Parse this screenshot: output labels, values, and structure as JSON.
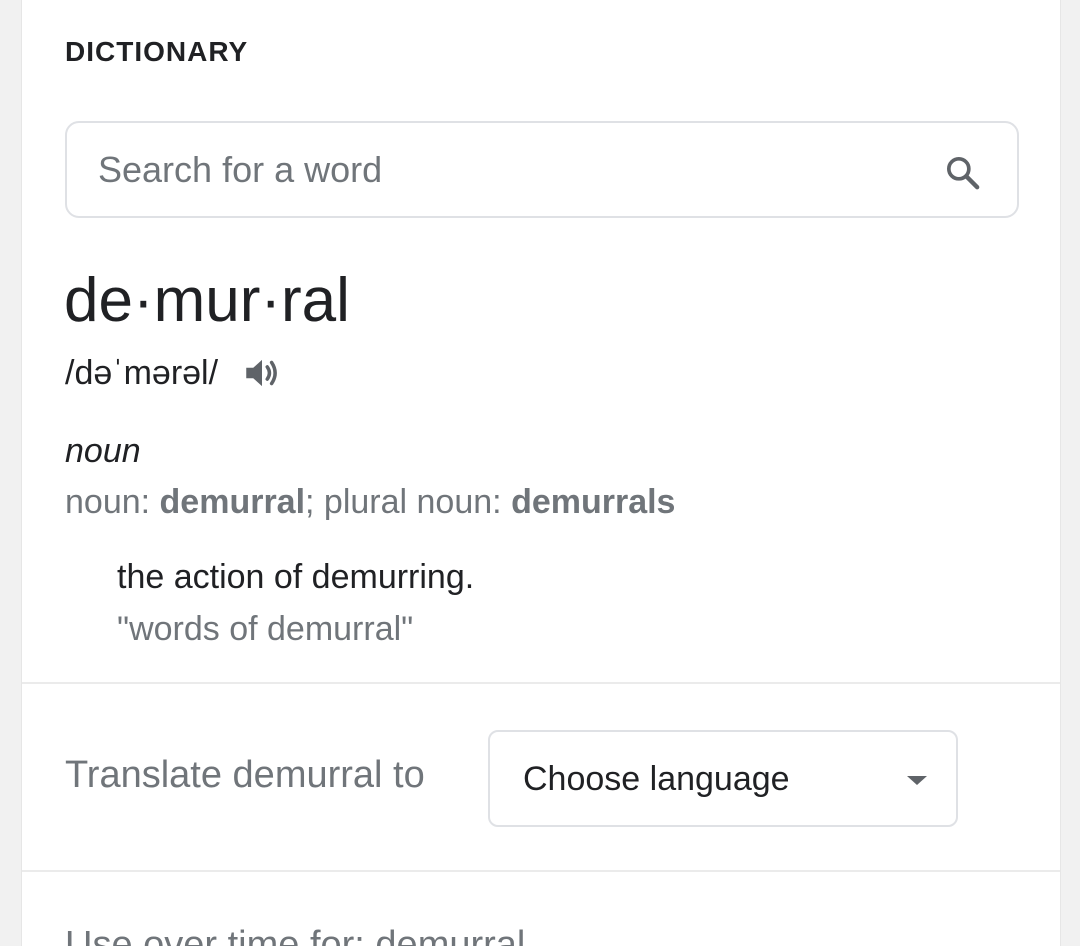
{
  "section": {
    "title": "DICTIONARY"
  },
  "search": {
    "placeholder": "Search for a word"
  },
  "entry": {
    "headword": "de·mur·ral",
    "phonetic": "/dəˈmərəl/",
    "part_of_speech": "noun",
    "forms": {
      "singular_prefix": "noun: ",
      "singular": "demurral",
      "separator": "; plural noun: ",
      "plural": "demurrals"
    },
    "definition": "the action of demurring.",
    "example": "\"words of demurral\""
  },
  "translate": {
    "label": "Translate demurral to",
    "select_value": "Choose language"
  },
  "usage": {
    "title": "Use over time for: demurral"
  },
  "icons": {
    "search": "search-icon",
    "audio": "speaker-icon",
    "dropdown": "dropdown-arrow-icon"
  }
}
